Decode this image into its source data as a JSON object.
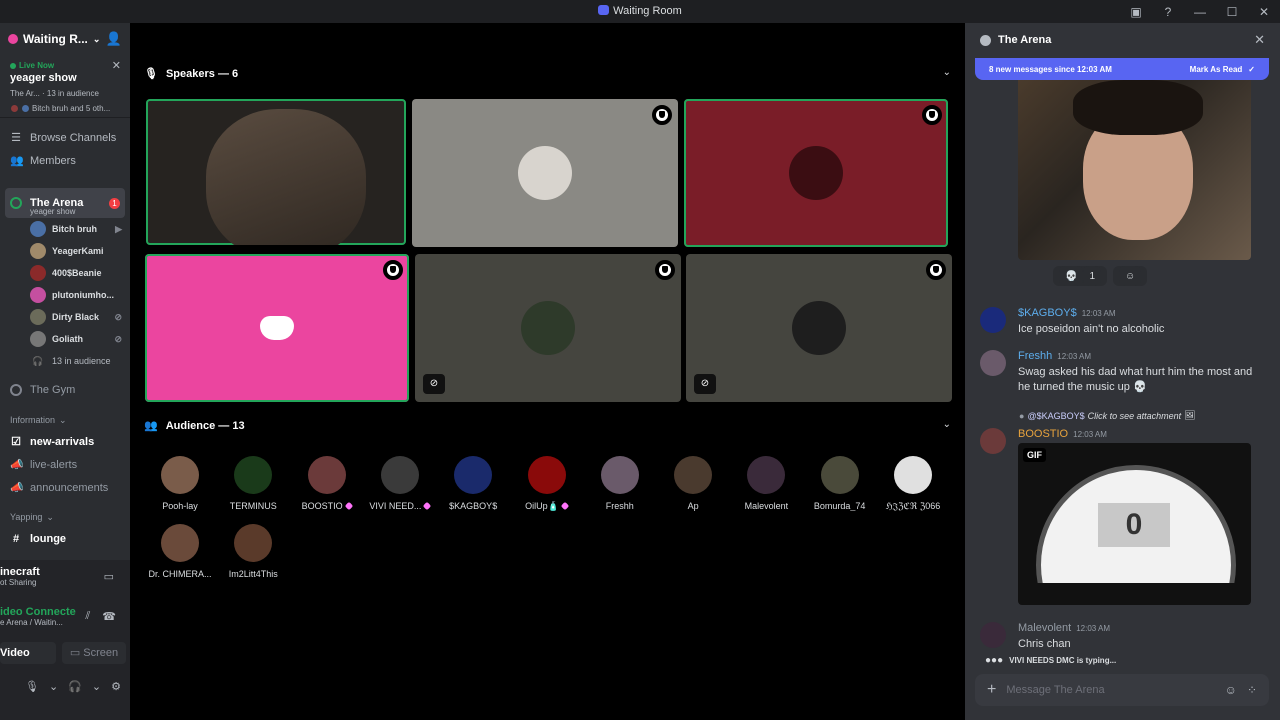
{
  "window": {
    "title": "Waiting Room"
  },
  "sidebar": {
    "server_name": "Waiting R...",
    "live": {
      "label": "Live Now",
      "title": "yeager show",
      "meta": "The Ar... · 13 in audience",
      "participants": "Bitch bruh and 5 oth..."
    },
    "nav": [
      {
        "label": "Browse Channels",
        "icon": "grid-icon"
      },
      {
        "label": "Members",
        "icon": "members-icon"
      }
    ],
    "active_channel": {
      "name": "The Arena",
      "sub": "yeager show",
      "badge": "1"
    },
    "voice_members": [
      {
        "name": "Bitch bruh",
        "color": "#4a6fa5",
        "status": "▶"
      },
      {
        "name": "YeagerKami",
        "color": "#a08a6a",
        "status": ""
      },
      {
        "name": "400$Beanie",
        "color": "#8b2a2a",
        "status": ""
      },
      {
        "name": "plutoniumho...",
        "color": "#c54fa0",
        "status": ""
      },
      {
        "name": "Dirty Black",
        "color": "#6b6b5a",
        "status": "⊘"
      },
      {
        "name": "Goliath",
        "color": "#777",
        "status": "⊘"
      }
    ],
    "audience_count": "13 in audience",
    "gym": "The Gym",
    "sections": [
      {
        "label": "Information",
        "channels": [
          {
            "name": "new-arrivals",
            "unread": true,
            "icon": "rules-icon"
          },
          {
            "name": "live-alerts",
            "unread": false,
            "icon": "megaphone-icon"
          },
          {
            "name": "announcements",
            "unread": false,
            "icon": "megaphone-icon"
          }
        ]
      },
      {
        "label": "Yapping",
        "channels": [
          {
            "name": "lounge",
            "unread": true,
            "icon": "hash-icon"
          }
        ]
      }
    ]
  },
  "user_panel": {
    "activity": "inecraft",
    "activity_sub": "ot Sharing",
    "connection": "ideo Connecte",
    "connection_sub": "e Arena / Waitin...",
    "video_label": "Video",
    "screen_label": "Screen"
  },
  "speakers": {
    "header": "Speakers — 6",
    "tiles": [
      {
        "name": "video-feed",
        "bg": "#262320",
        "speaking": true,
        "shield": false,
        "muted": false,
        "avatar": false
      },
      {
        "name": "avatar-tile",
        "bg": "#8a8984",
        "speaking": false,
        "shield": true,
        "muted": false,
        "avatar": true,
        "avcolor": "#d8d4ce"
      },
      {
        "name": "avatar-tile",
        "bg": "#7a1d28",
        "speaking": true,
        "shield": true,
        "muted": false,
        "avatar": true,
        "avcolor": "#3b0d12"
      },
      {
        "name": "discord-default-tile",
        "bg": "#eb459f",
        "speaking": true,
        "shield": true,
        "muted": false,
        "avatar": false
      },
      {
        "name": "avatar-tile",
        "bg": "#45453f",
        "speaking": false,
        "shield": true,
        "muted": true,
        "avatar": true,
        "avcolor": "#2e3a2a"
      },
      {
        "name": "avatar-tile",
        "bg": "#45453f",
        "speaking": false,
        "shield": true,
        "muted": true,
        "avatar": true,
        "avcolor": "#1e1e1e"
      }
    ]
  },
  "audience": {
    "header": "Audience — 13",
    "members": [
      {
        "name": "Pooh-lay",
        "color": "#7a5c4a",
        "boost": false
      },
      {
        "name": "TERMINUS",
        "color": "#1a3a1a",
        "boost": false
      },
      {
        "name": "BOOSTIO",
        "color": "#6b3a3a",
        "boost": true
      },
      {
        "name": "VIVI NEED...",
        "color": "#3a3a3a",
        "boost": true
      },
      {
        "name": "$KAGBOY$",
        "color": "#1a2a6b",
        "boost": false
      },
      {
        "name": "OilUp🧴",
        "color": "#8a0a0a",
        "boost": true
      },
      {
        "name": "Freshh",
        "color": "#6a5a6a",
        "boost": false
      },
      {
        "name": "Ap",
        "color": "#4a3a2e",
        "boost": false
      },
      {
        "name": "Malevolent",
        "color": "#3a2a3a",
        "boost": false
      },
      {
        "name": "Bomurda_74",
        "color": "#4a4a3a",
        "boost": false
      },
      {
        "name": "ℌ𝔍ℨℭℜ ℨ066",
        "color": "#e0e0e0",
        "boost": false
      },
      {
        "name": "Dr. CHIMERA...",
        "color": "#6a4a3a",
        "boost": false
      },
      {
        "name": "Im2Litt4This",
        "color": "#5a3a2a",
        "boost": false
      }
    ]
  },
  "chat": {
    "title": "The Arena",
    "new_messages": "8 new messages since 12:03 AM",
    "mark_read": "Mark As Read",
    "reaction_count": "1",
    "messages": [
      {
        "author": "$KAGBOY$",
        "color": "#5dadec",
        "time": "12:03 AM",
        "text": "Ice poseidon ain't no alcoholic",
        "avcolor": "#1a2a7b"
      },
      {
        "author": "Freshh",
        "color": "#5dadec",
        "time": "12:03 AM",
        "text": "Swag asked his dad what hurt him the most and he turned the music up 💀",
        "avcolor": "#6a5a6a"
      },
      {
        "author": "BOOSTIO",
        "color": "#e8a33d",
        "time": "12:03 AM",
        "text": "",
        "avcolor": "#6b3a3a"
      },
      {
        "author": "Malevolent",
        "color": "#949ba4",
        "time": "12:03 AM",
        "text": "Chris chan",
        "avcolor": "#3a2a3a"
      }
    ],
    "reply": {
      "mention": "@$KAGBOY$",
      "note": "Click to see attachment"
    },
    "gif": {
      "badge": "GIF",
      "value": "0"
    },
    "typing": "VIVI NEEDS DMC is typing...",
    "placeholder": "Message The Arena"
  }
}
